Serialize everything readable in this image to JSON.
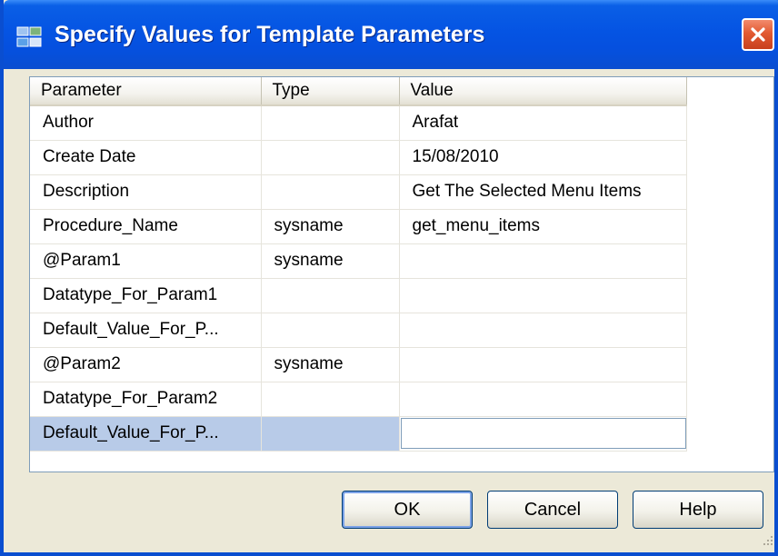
{
  "window": {
    "title": "Specify Values for Template Parameters",
    "icon": "template-params-icon",
    "close_icon": "close-icon"
  },
  "table": {
    "columns": [
      "Parameter",
      "Type",
      "Value"
    ],
    "rows": [
      {
        "parameter": "Author",
        "type": "",
        "value": "Arafat"
      },
      {
        "parameter": "Create Date",
        "type": "",
        "value": "15/08/2010"
      },
      {
        "parameter": "Description",
        "type": "",
        "value": "Get The Selected Menu Items"
      },
      {
        "parameter": "Procedure_Name",
        "type": "sysname",
        "value": "get_menu_items"
      },
      {
        "parameter": "@Param1",
        "type": "sysname",
        "value": ""
      },
      {
        "parameter": "Datatype_For_Param1",
        "type": "",
        "value": ""
      },
      {
        "parameter": "Default_Value_For_P...",
        "type": "",
        "value": ""
      },
      {
        "parameter": "@Param2",
        "type": "sysname",
        "value": ""
      },
      {
        "parameter": "Datatype_For_Param2",
        "type": "",
        "value": ""
      },
      {
        "parameter": "Default_Value_For_P...",
        "type": "",
        "value": ""
      }
    ],
    "selected_row": 9
  },
  "buttons": {
    "ok": "OK",
    "cancel": "Cancel",
    "help": "Help"
  },
  "colors": {
    "title_bar": "#0554e3",
    "selection": "#b8cbe8",
    "close_button": "#e25a32"
  }
}
